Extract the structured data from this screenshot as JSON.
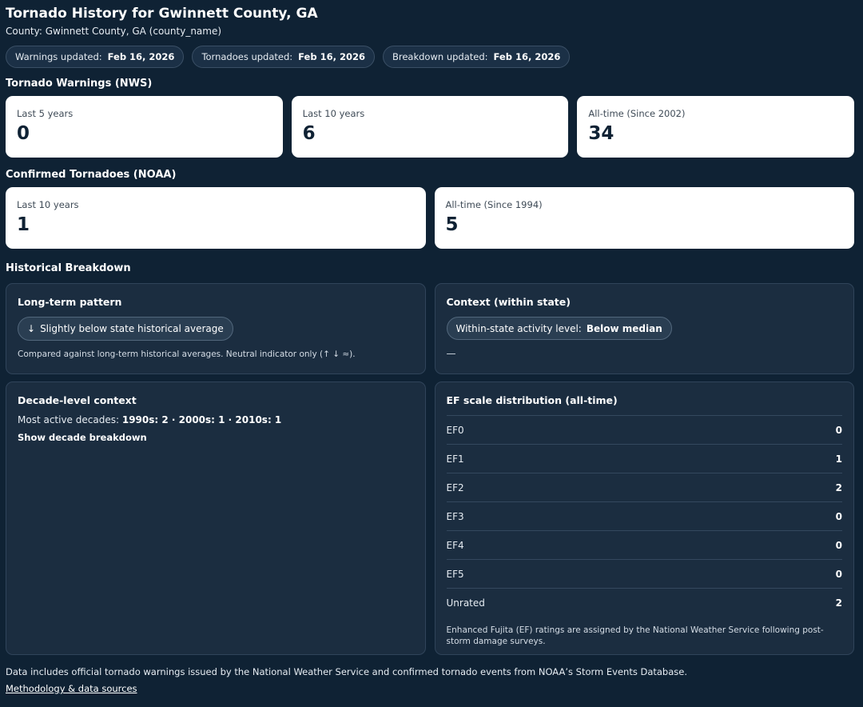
{
  "header": {
    "title": "Tornado History for Gwinnett County, GA",
    "subtitle": "County: Gwinnett County, GA (county_name)"
  },
  "updates": [
    {
      "label": "Warnings updated:",
      "date": "Feb 16, 2026"
    },
    {
      "label": "Tornadoes updated:",
      "date": "Feb 16, 2026"
    },
    {
      "label": "Breakdown updated:",
      "date": "Feb 16, 2026"
    }
  ],
  "warnings": {
    "title": "Tornado Warnings (NWS)",
    "stats": [
      {
        "label": "Last 5 years",
        "value": "0"
      },
      {
        "label": "Last 10 years",
        "value": "6"
      },
      {
        "label": "All-time (Since 2002)",
        "value": "34"
      }
    ]
  },
  "tornadoes": {
    "title": "Confirmed Tornadoes (NOAA)",
    "stats": [
      {
        "label": "Last 10 years",
        "value": "1"
      },
      {
        "label": "All-time (Since 1994)",
        "value": "5"
      }
    ]
  },
  "breakdown": {
    "title": "Historical Breakdown",
    "long_term": {
      "title": "Long-term pattern",
      "arrow": "↓",
      "chip": "Slightly below state historical average",
      "note": "Compared against long-term historical averages. Neutral indicator only (↑ ↓ ≈)."
    },
    "context": {
      "title": "Context (within state)",
      "chip_label": "Within-state activity level:",
      "chip_value": "Below median",
      "detail": "—"
    },
    "decade": {
      "title": "Decade-level context",
      "prefix": "Most active decades:",
      "value": "1990s: 2 · 2000s: 1 · 2010s: 1",
      "toggle": "Show decade breakdown"
    },
    "ef": {
      "title": "EF scale distribution (all-time)",
      "rows": [
        {
          "label": "EF0",
          "value": "0"
        },
        {
          "label": "EF1",
          "value": "1"
        },
        {
          "label": "EF2",
          "value": "2"
        },
        {
          "label": "EF3",
          "value": "0"
        },
        {
          "label": "EF4",
          "value": "0"
        },
        {
          "label": "EF5",
          "value": "0"
        },
        {
          "label": "Unrated",
          "value": "2"
        }
      ],
      "note": "Enhanced Fujita (EF) ratings are assigned by the National Weather Service following post-storm damage surveys."
    }
  },
  "footer": {
    "text": "Data includes official tornado warnings issued by the National Weather Service and confirmed tornado events from NOAA’s Storm Events Database.",
    "link": "Methodology & data sources"
  }
}
